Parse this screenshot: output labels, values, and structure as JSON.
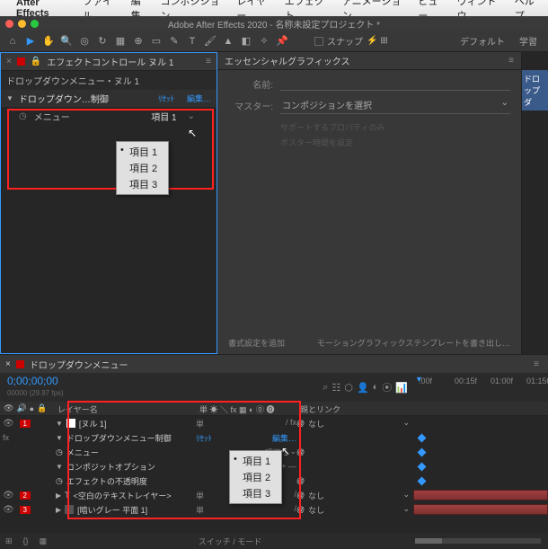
{
  "menubar": {
    "app": "After Effects",
    "items": [
      "ファイル",
      "編集",
      "コンポジション",
      "レイヤー",
      "エフェクト",
      "アニメーション",
      "ビュー",
      "ウィンドウ",
      "ヘルプ"
    ]
  },
  "titlebar": "Adobe After Effects 2020 - 名称未設定プロジェクト *",
  "toolbar": {
    "snap": "スナップ",
    "default": "デフォルト",
    "learn": "学習"
  },
  "effects_panel": {
    "tab": "エフェクトコントロール ヌル 1",
    "header": "ドロップダウンメニュー・ヌル 1",
    "fx_name": "ドロップダウン…制御",
    "reset": "ﾘｾｯﾄ",
    "edit": "編集…",
    "menu_label": "メニュー",
    "menu_value": "項目 1",
    "options": [
      "項目 1",
      "項目 2",
      "項目 3"
    ]
  },
  "essential": {
    "tab": "エッセンシャルグラフィックス",
    "name_label": "名前:",
    "master_label": "マスター:",
    "master_value": "コンポジションを選択",
    "sub1": "サポートするプロパティのみ",
    "sub2": "ポスター時間を設定",
    "footer1": "書式設定を追加",
    "footer2": "モーショングラフィックステンプレートを書き出し…"
  },
  "far_tab": "ドロップダ",
  "timeline": {
    "tab": "ドロップダウンメニュー",
    "time": "0;00;00;00",
    "fps": "00000 (29.97 fps)",
    "ruler": [
      ":00f",
      "00:15f",
      "01:00f",
      "01:15f"
    ],
    "col_layer": "レイヤー名",
    "col_switch": "",
    "col_parent": "親とリンク",
    "layers": {
      "l1": {
        "name": "[ヌル 1]",
        "mode": "単",
        "parent": "なし"
      },
      "fx": {
        "name": "ドロップダウンメニュー制御",
        "reset": "ﾘｾｯﾄ",
        "edit": "編集…"
      },
      "menu": {
        "label": "メニュー",
        "value": "項目 1"
      },
      "comp": "コンポジットオプション",
      "opacity": "エフェクトの不透明度",
      "l2": {
        "name": "<空白のテキストレイヤー>",
        "mode": "単",
        "parent": "なし"
      },
      "l3": {
        "name": "[暗いグレー 平面 1]",
        "mode": "単",
        "parent": "なし"
      }
    },
    "dd_options": [
      "項目 1",
      "項目 2",
      "項目 3"
    ],
    "footer": "スイッチ / モード"
  }
}
